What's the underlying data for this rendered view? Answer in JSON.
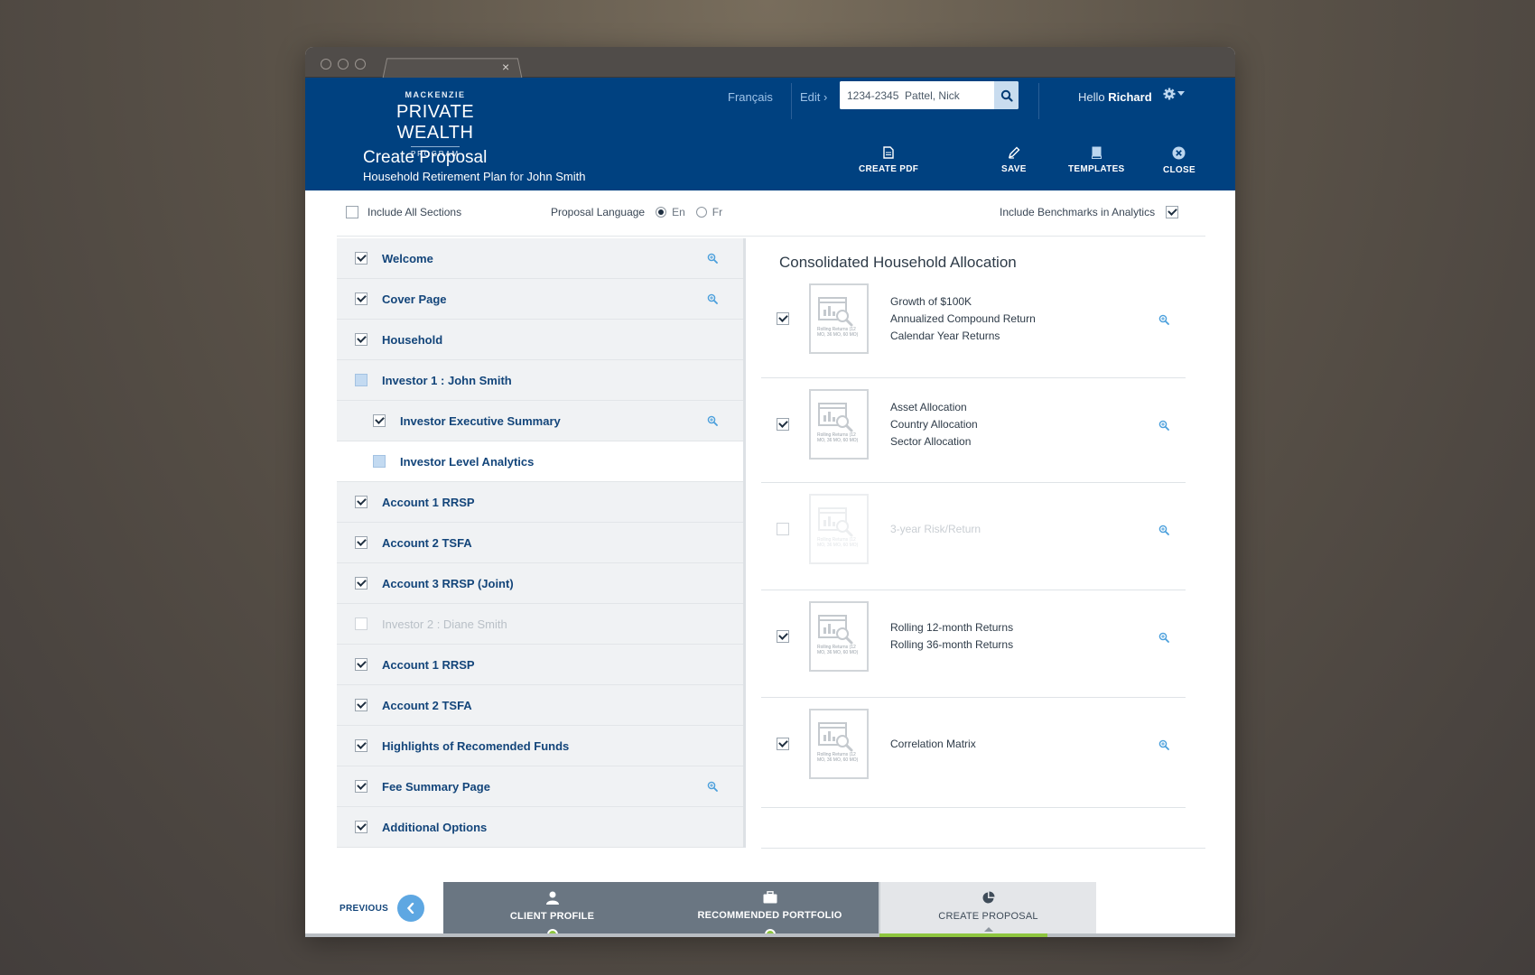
{
  "header": {
    "logo": {
      "top": "MACKENZIE",
      "main": "PRIVATE WEALTH",
      "bottom": "PROGRAM"
    },
    "language_link": "Français",
    "edit_link": "Edit ›",
    "search": {
      "value": "1234-2345  Pattel, Nick",
      "placeholder": ""
    },
    "greeting": "Hello",
    "user_name": "Richard",
    "title": "Create Proposal",
    "subtitle_plan": "Household Retirement Plan",
    "subtitle_for": "for",
    "subtitle_client": "John Smith",
    "actions": [
      {
        "label": "CREATE PDF",
        "icon": "document-icon"
      },
      {
        "label": "SAVE",
        "icon": "pencil-icon"
      },
      {
        "label": "TEMPLATES",
        "icon": "book-icon"
      },
      {
        "label": "CLOSE",
        "icon": "close-circle-icon"
      }
    ]
  },
  "options": {
    "include_all": {
      "label": "Include All Sections",
      "checked": false
    },
    "proposal_language": {
      "label": "Proposal Language",
      "options": [
        "En",
        "Fr"
      ],
      "selected": "En"
    },
    "benchmarks": {
      "label": "Include Benchmarks in Analytics",
      "checked": true
    }
  },
  "sections": [
    {
      "label": "Welcome",
      "state": "checked",
      "zoom": true
    },
    {
      "label": "Cover Page",
      "state": "checked",
      "zoom": true
    },
    {
      "label": "Household",
      "state": "checked",
      "zoom": false
    },
    {
      "label": "Investor 1 : John Smith",
      "state": "partial",
      "zoom": false
    },
    {
      "label": "Investor Executive Summary",
      "state": "checked",
      "zoom": true,
      "indent": true
    },
    {
      "label": "Investor Level Analytics",
      "state": "partial",
      "zoom": false,
      "indent": true,
      "active": true
    },
    {
      "label": "Account 1 RRSP",
      "state": "checked",
      "zoom": false
    },
    {
      "label": "Account 2 TSFA",
      "state": "checked",
      "zoom": false
    },
    {
      "label": "Account 3 RRSP (Joint)",
      "state": "checked",
      "zoom": false
    },
    {
      "label": "Investor 2 : Diane Smith",
      "state": "unchecked",
      "zoom": false,
      "muted": true
    },
    {
      "label": "Account 1 RRSP",
      "state": "checked",
      "zoom": false
    },
    {
      "label": "Account 2 TSFA",
      "state": "checked",
      "zoom": false
    },
    {
      "label": "Highlights of Recomended Funds",
      "state": "checked",
      "zoom": false
    },
    {
      "label": "Fee Summary Page",
      "state": "checked",
      "zoom": true
    },
    {
      "label": "Additional Options",
      "state": "checked",
      "zoom": false
    }
  ],
  "right_panel": {
    "title": "Consolidated Household Allocation",
    "thumbnail_caption": "Rolling Returns (12 MO, 36 MO, 60 MO)",
    "cards": [
      {
        "checked": true,
        "disabled": false,
        "lines": [
          "Growth of $100K",
          "Annualized Compound Return",
          "Calendar Year Returns"
        ]
      },
      {
        "checked": true,
        "disabled": false,
        "lines": [
          "Asset Allocation",
          "Country Allocation",
          "Sector Allocation"
        ]
      },
      {
        "checked": false,
        "disabled": true,
        "lines": [
          "3-year Risk/Return"
        ]
      },
      {
        "checked": true,
        "disabled": false,
        "lines": [
          "Rolling 12-month Returns",
          "Rolling 36-month Returns"
        ]
      },
      {
        "checked": true,
        "disabled": false,
        "lines": [
          "Correlation Matrix"
        ]
      }
    ]
  },
  "footer": {
    "previous_label": "PREVIOUS",
    "steps": [
      {
        "label": "CLIENT PROFILE",
        "icon": "person-icon",
        "status": "done"
      },
      {
        "label": "RECOMMENDED PORTFOLIO",
        "icon": "briefcase-icon",
        "status": "done"
      },
      {
        "label": "CREATE PROPOSAL",
        "icon": "pie-chart-icon",
        "status": "current"
      }
    ]
  },
  "colors": {
    "header_bg": "#004180",
    "link": "#13457a",
    "accent": "#5ea7e2",
    "success": "#8ec63f"
  }
}
